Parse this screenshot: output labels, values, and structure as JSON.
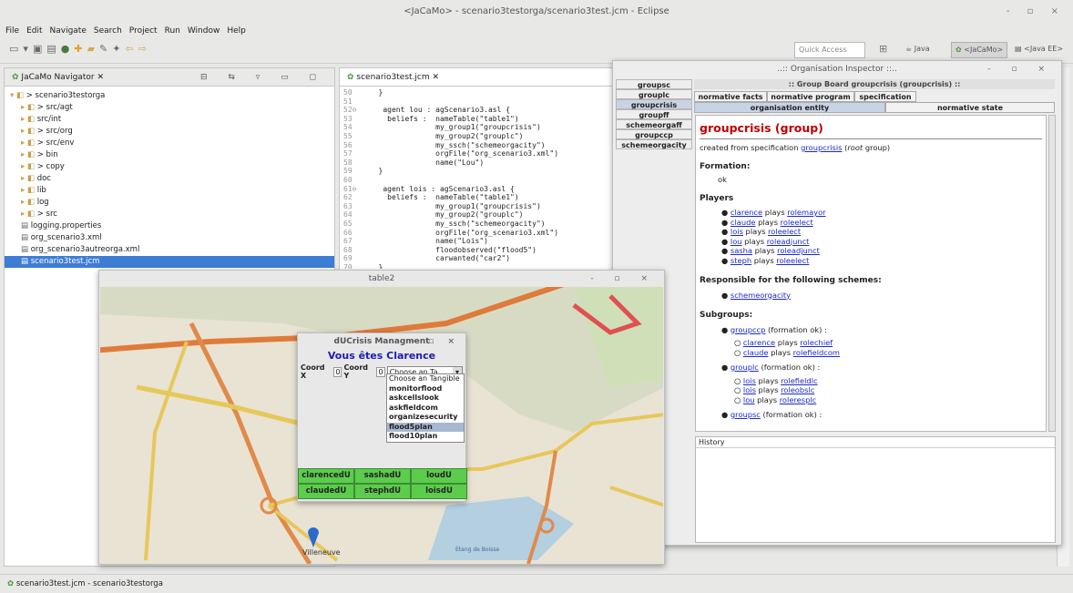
{
  "window": {
    "title": "<JaCaMo> - scenario3testorga/scenario3test.jcm - Eclipse"
  },
  "menu": [
    "File",
    "Edit",
    "Navigate",
    "Search",
    "Project",
    "Run",
    "Window",
    "Help"
  ],
  "toolbar": {
    "quick_access": "Quick Access"
  },
  "perspectives": [
    {
      "label": "Java",
      "icon": "java-icon"
    },
    {
      "label": "<JaCaMo>",
      "icon": "jacamo-icon"
    },
    {
      "label": "<Java EE>",
      "icon": "javaee-icon"
    }
  ],
  "navigator": {
    "title": "JaCaMo Navigator",
    "items": [
      {
        "label": "> scenario3testorga",
        "indent": 0,
        "icon": "project-icon"
      },
      {
        "label": "> src/agt",
        "indent": 1,
        "icon": "folder-icon"
      },
      {
        "label": "src/int",
        "indent": 1,
        "icon": "folder-icon"
      },
      {
        "label": "> src/org",
        "indent": 1,
        "icon": "folder-icon"
      },
      {
        "label": "> src/env",
        "indent": 1,
        "icon": "folder-icon"
      },
      {
        "label": "> bin",
        "indent": 1,
        "icon": "folder-icon"
      },
      {
        "label": "> copy",
        "indent": 1,
        "icon": "folder-icon"
      },
      {
        "label": "doc",
        "indent": 1,
        "icon": "folder-icon"
      },
      {
        "label": "lib",
        "indent": 1,
        "icon": "folder-icon"
      },
      {
        "label": "log",
        "indent": 1,
        "icon": "folder-icon"
      },
      {
        "label": "> src",
        "indent": 1,
        "icon": "folder-icon"
      },
      {
        "label": "logging.properties",
        "indent": 1,
        "icon": "file-icon"
      },
      {
        "label": "org_scenario3.xml",
        "indent": 1,
        "icon": "xml-icon"
      },
      {
        "label": "org_scenario3autreorga.xml",
        "indent": 1,
        "icon": "xml-icon"
      },
      {
        "label": "scenario3test.jcm",
        "indent": 1,
        "icon": "jcm-icon",
        "selected": true
      }
    ]
  },
  "editor": {
    "tab": "scenario3test.jcm",
    "lines": [
      {
        "n": "50",
        "t": "    }"
      },
      {
        "n": "51",
        "t": ""
      },
      {
        "n": "52⊖",
        "t": "    agent lou : agScenario3.asl {"
      },
      {
        "n": "53",
        "t": "      beliefs :  nameTable(\"table1\")"
      },
      {
        "n": "54",
        "t": "                 my_group1(\"groupcrisis\")"
      },
      {
        "n": "55",
        "t": "                 my_group2(\"grouplc\")"
      },
      {
        "n": "56",
        "t": "                 my_ssch(\"schemeorgacity\")"
      },
      {
        "n": "57",
        "t": "                 orgFile(\"org_scenario3.xml\")"
      },
      {
        "n": "58",
        "t": "                 name(\"Lou\")"
      },
      {
        "n": "59",
        "t": "    }"
      },
      {
        "n": "60",
        "t": ""
      },
      {
        "n": "61⊖",
        "t": "    agent lois : agScenario3.asl {"
      },
      {
        "n": "62",
        "t": "      beliefs :  nameTable(\"table1\")"
      },
      {
        "n": "63",
        "t": "                 my_group1(\"groupcrisis\")"
      },
      {
        "n": "64",
        "t": "                 my_group2(\"grouplc\")"
      },
      {
        "n": "65",
        "t": "                 my_ssch(\"schemeorgacity\")"
      },
      {
        "n": "66",
        "t": "                 orgFile(\"org_scenario3.xml\")"
      },
      {
        "n": "67",
        "t": "                 name(\"Lois\")"
      },
      {
        "n": "68",
        "t": "                 floodobserved(\"flood5\")"
      },
      {
        "n": "69",
        "t": "                 carwanted(\"car2\")"
      },
      {
        "n": "70",
        "t": "    }"
      },
      {
        "n": "71",
        "t": ""
      }
    ]
  },
  "inspector": {
    "title": "..:: Organisation Inspector ::..",
    "board_title": ":: Group Board groupcrisis (groupcrisis) ::",
    "groups": [
      "groupsc",
      "grouplc",
      "groupcrisis",
      "groupff",
      "schemeorgaff",
      "groupccp",
      "schemeorgacity"
    ],
    "active_group": "groupcrisis",
    "tabs_row1": [
      "normative facts",
      "normative program",
      "specification"
    ],
    "tabs_row2": [
      "organisation entity",
      "normative state"
    ],
    "heading": "groupcrisis (group)",
    "created_prefix": "created from specification ",
    "created_link": "groupcrisis",
    "created_paren": " (",
    "created_root": "root",
    "created_suffix": " group)",
    "formation_label": "Formation:",
    "formation_value": "ok",
    "players_label": "Players",
    "plays_word": "plays",
    "players": [
      {
        "agent": "clarence",
        "role": "rolemayor"
      },
      {
        "agent": "claude",
        "role": "roleelect"
      },
      {
        "agent": "lois",
        "role": "roleelect"
      },
      {
        "agent": "lou",
        "role": "roleadjunct"
      },
      {
        "agent": "sasha",
        "role": "roleadjunct"
      },
      {
        "agent": "steph",
        "role": "roleelect"
      }
    ],
    "responsible_label": "Responsible for the following schemes:",
    "schemes": [
      "schemeorgacity"
    ],
    "subgroups_label": "Subgroups:",
    "formation_ok": " (formation ok) :",
    "subgroups": [
      {
        "name": "groupccp",
        "players": [
          {
            "agent": "clarence",
            "role": "rolechief"
          },
          {
            "agent": "claude",
            "role": "rolefieldcom"
          }
        ]
      },
      {
        "name": "grouplc",
        "players": [
          {
            "agent": "lois",
            "role": "rolefieldlc"
          },
          {
            "agent": "lois",
            "role": "roleobslc"
          },
          {
            "agent": "lou",
            "role": "roleresplc"
          }
        ]
      },
      {
        "name": "groupsc",
        "players": []
      }
    ],
    "history_label": "History"
  },
  "map_window": {
    "title": "table2",
    "map_labels": [
      "Villeneuve",
      "Etang de Boisse"
    ]
  },
  "dialog": {
    "title": "dUCrisis Managment",
    "greeting": "Vous êtes Clarence",
    "coord_x_label": "Coord X",
    "coord_x": "0",
    "coord_y_label": "Coord Y",
    "coord_y": "0",
    "select_value": "Choose an Ta...",
    "options": [
      "Choose an Tangible",
      "monitorflood",
      "askcellslook",
      "askfieldcom",
      "organizesecurity",
      "flood5plan",
      "flood10plan"
    ],
    "highlighted_option": "flood5plan",
    "agent_buttons": [
      "clarencedU",
      "sashadU",
      "loudU",
      "claudedU",
      "stephdU",
      "loisdU"
    ]
  },
  "statusbar": {
    "text": "scenario3test.jcm - scenario3testorga"
  }
}
